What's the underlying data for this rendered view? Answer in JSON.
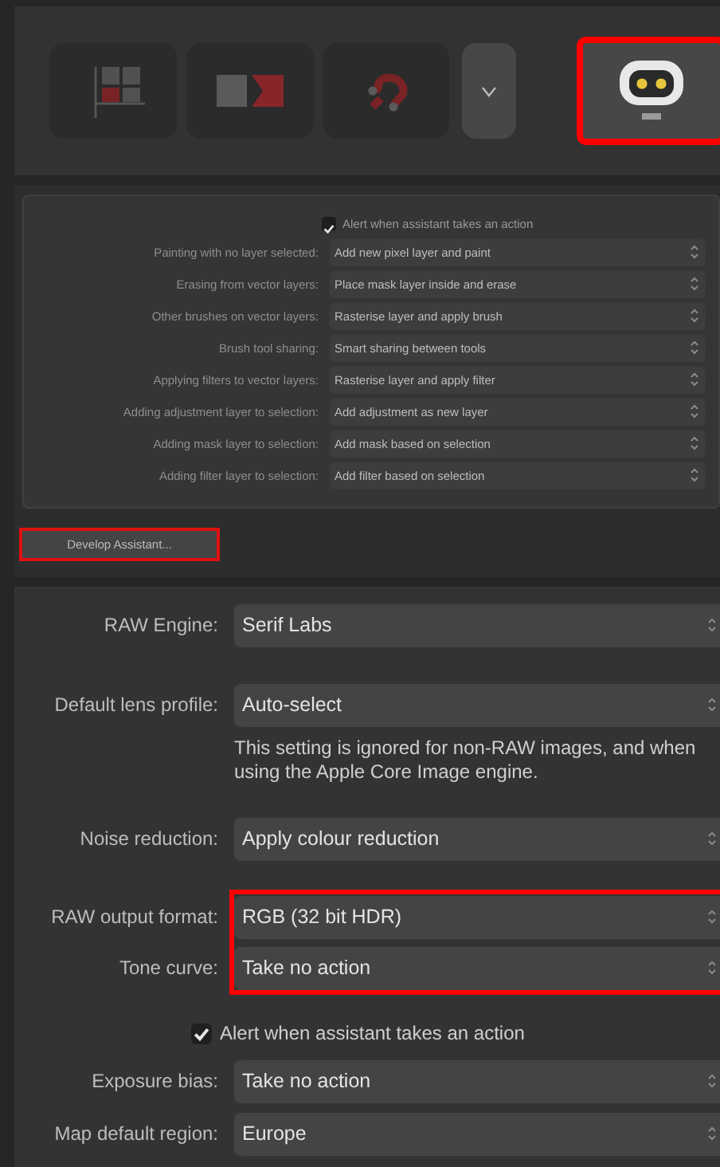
{
  "toolbar": {
    "buttons": [
      {
        "kind": "grid",
        "selected": false
      },
      {
        "kind": "blocks",
        "selected": false
      },
      {
        "kind": "magnet",
        "selected": false
      },
      {
        "kind": "chevron",
        "selected": false
      },
      {
        "kind": "robot",
        "selected": true,
        "highlighted": true
      }
    ]
  },
  "assistant_panel": {
    "alert": {
      "label": "Alert when assistant takes an action",
      "checked": true
    },
    "rows": [
      {
        "label": "Painting with no layer selected:",
        "value": "Add new pixel layer and paint"
      },
      {
        "label": "Erasing from vector layers:",
        "value": "Place mask layer inside and erase"
      },
      {
        "label": "Other brushes on vector layers:",
        "value": "Rasterise layer and apply brush"
      },
      {
        "label": "Brush tool sharing:",
        "value": "Smart sharing between tools"
      },
      {
        "label": "Applying filters to vector layers:",
        "value": "Rasterise layer and apply filter"
      },
      {
        "label": "Adding adjustment layer to selection:",
        "value": "Add adjustment as new layer"
      },
      {
        "label": "Adding mask layer to selection:",
        "value": "Add mask based on selection"
      },
      {
        "label": "Adding filter layer to selection:",
        "value": "Add filter based on selection"
      }
    ],
    "button": {
      "label": "Develop Assistant...",
      "highlighted": true
    }
  },
  "develop_panel": {
    "items": [
      {
        "kind": "select",
        "label": "RAW Engine:",
        "value": "Serif Labs"
      },
      {
        "kind": "select",
        "label": "Default lens profile:",
        "value": "Auto-select"
      },
      {
        "kind": "note",
        "text": "This setting is ignored for non-RAW images, and when using the Apple Core Image engine."
      },
      {
        "kind": "select",
        "label": "Noise reduction:",
        "value": "Apply colour reduction"
      },
      {
        "kind": "group",
        "highlighted": true,
        "items": [
          {
            "kind": "select",
            "label": "RAW output format:",
            "value": "RGB (32 bit HDR)"
          },
          {
            "kind": "select",
            "label": "Tone curve:",
            "value": "Take no action"
          }
        ]
      },
      {
        "kind": "checkbox",
        "label": "Alert when assistant takes an action",
        "checked": true
      },
      {
        "kind": "select",
        "label": "Exposure bias:",
        "value": "Take no action"
      },
      {
        "kind": "select",
        "label": "Map default region:",
        "value": "Europe"
      }
    ]
  }
}
